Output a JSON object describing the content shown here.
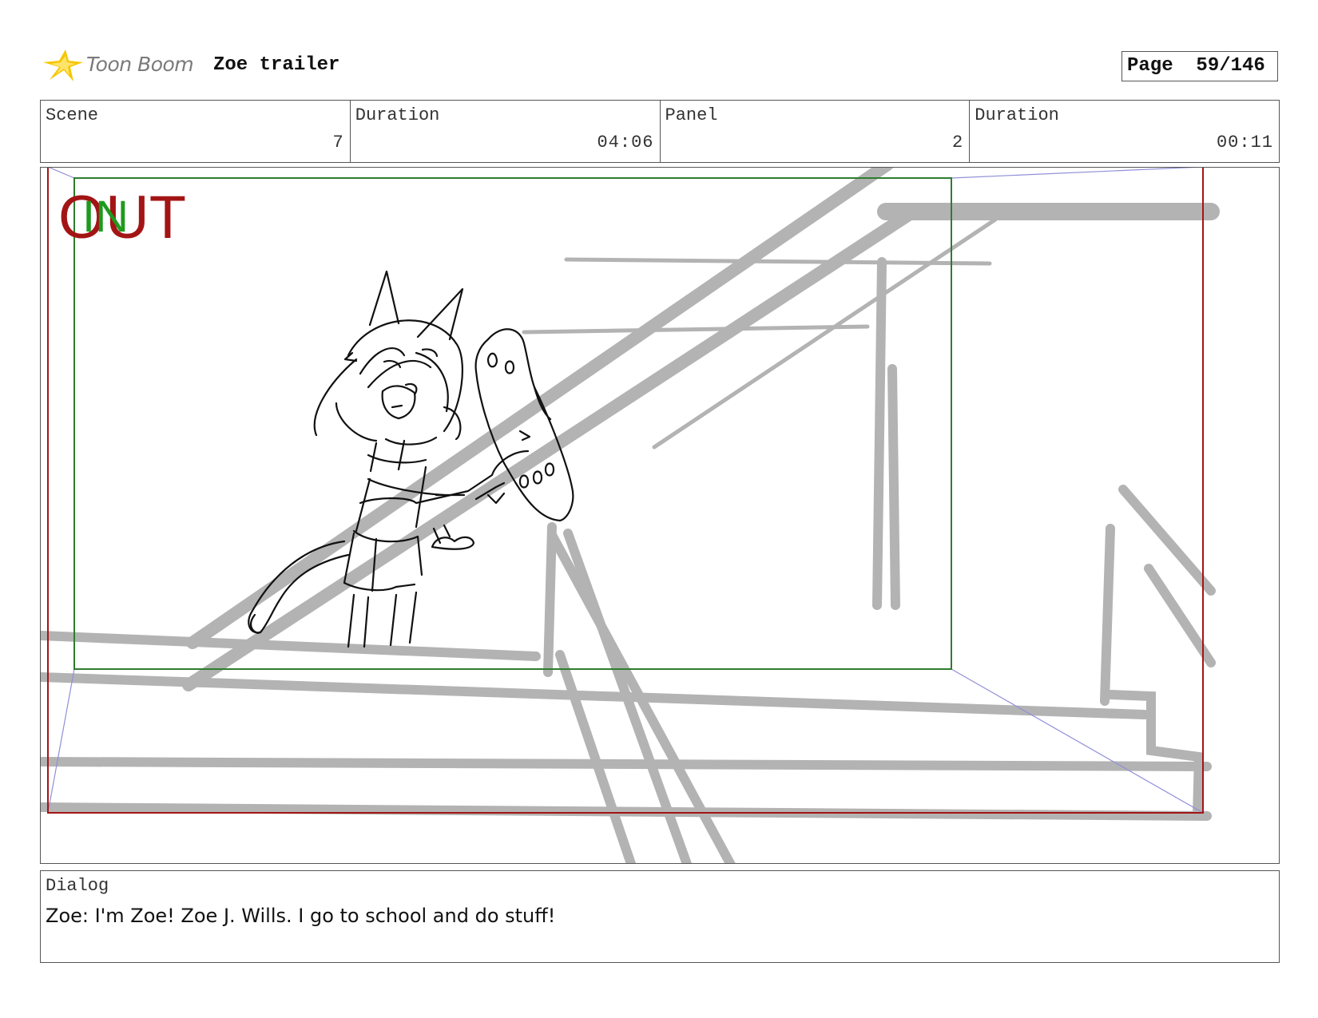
{
  "header": {
    "logo_text": "Toon Boom",
    "project_title": "Zoe trailer",
    "page_label": "Page",
    "page_value": "59/146"
  },
  "info": {
    "scene_label": "Scene",
    "scene_value": "7",
    "scene_duration_label": "Duration",
    "scene_duration_value": "04:06",
    "panel_label": "Panel",
    "panel_value": "2",
    "panel_duration_label": "Duration",
    "panel_duration_value": "00:11"
  },
  "frame": {
    "out_marker": "OUT",
    "in_marker": "IN",
    "colors": {
      "out": "#a31515",
      "in": "#1e9a1e",
      "safe_area": "#2e7d2e",
      "camera_path": "#8f8fd8",
      "background_lines": "#b3b3b3"
    }
  },
  "dialog": {
    "label": "Dialog",
    "text": "Zoe: I'm Zoe! Zoe J. Wills. I go to school and do stuff!"
  }
}
